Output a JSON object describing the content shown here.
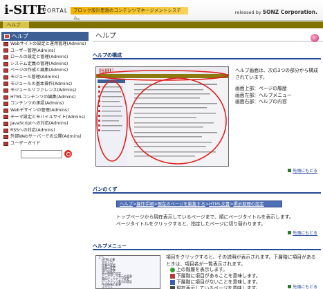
{
  "header": {
    "logo": "i-SITE",
    "logo_sub": "PORTAL",
    "tagline": "ブロック設計思想のコンテンツマネージメントシステム。",
    "released_by": "released by",
    "corp": "SONZ Corporation."
  },
  "breadcrumb": {
    "label": "ヘルプ"
  },
  "sidebar": {
    "title": "ヘルプ",
    "items": [
      {
        "label": "Webサイトの設定と運用管理(Admins)"
      },
      {
        "label": "ユーザー管理(Admins)"
      },
      {
        "label": "ロールの設定と管理(Admins)"
      },
      {
        "label": "システム定義の管理(Admins)"
      },
      {
        "label": "ページの作成と編集(Admins)"
      },
      {
        "label": "モジュール管理(Admins)"
      },
      {
        "label": "モジュールの基本操作(Admins)"
      },
      {
        "label": "モジュールリファレンス(Admins)"
      },
      {
        "label": "HTMLコンテンツの編集(Admins)"
      },
      {
        "label": "コンテンツの承認(Admins)"
      },
      {
        "label": "Webデザインの管理(Admins)"
      },
      {
        "label": "テーマ設定とモバイルサイト(Admins)"
      },
      {
        "label": "JavaScriptへの対応(Admins)"
      },
      {
        "label": "RSSへの対応(Admins)"
      },
      {
        "label": "外部Webサーバーでの公開(Admins)"
      },
      {
        "label": "ユーザーガイド"
      }
    ],
    "search": {
      "value": "",
      "placeholder": ""
    }
  },
  "main": {
    "title": "ヘルプ",
    "section1": {
      "heading": "ヘルプの構成",
      "intro": "ヘルプ画面は、次の3つの部分から構成されています。",
      "lines": [
        "画面上部：ページの履歴",
        "画面左部：ヘルプメニュー",
        "画面右部：ヘルプの内容"
      ],
      "totop": "先頭にもどる"
    },
    "section2": {
      "heading": "パンのくず",
      "crumbs": [
        "ヘルプ",
        "操作手順",
        "現在のページを編集する",
        "HTML文書",
        "掲示期間の設定"
      ],
      "sep": ">",
      "desc1": "トップページから現在表示しているページまで、順にページタイトルを表示します。",
      "desc2": "ページタイトルをクリックすると、指定したページに切り替わります。",
      "totop": "先頭にもどる"
    },
    "section3": {
      "heading": "ヘルプメニュー",
      "desc1": "項目をクリックすると、その説明が表示されます。下層階に項目があるときは、項目名が一覧表示されます。",
      "legend": [
        {
          "label": "上の階層を表示します。",
          "color": "#3a9a3a"
        },
        {
          "label": "下層階に項目があることを意味します。",
          "color": "#b53b3b"
        },
        {
          "label": "下層階に項目がないことを意味します。",
          "color": "#3a5fb3"
        },
        {
          "label": "現在表示しているページを意味します。",
          "color": "#444"
        }
      ],
      "totop": "先頭にもどる",
      "thumb_items": [
        "上へ",
        "HTML文書",
        "文の入力",
        "作業の変更",
        "画像の変更",
        "添付の変更",
        "表示期間の設定",
        "ピックアップ表示の変更",
        "資料ピックアップ変更",
        "ピックアップ表示の設定",
        "作成情報の変更",
        "イベント"
      ]
    }
  }
}
